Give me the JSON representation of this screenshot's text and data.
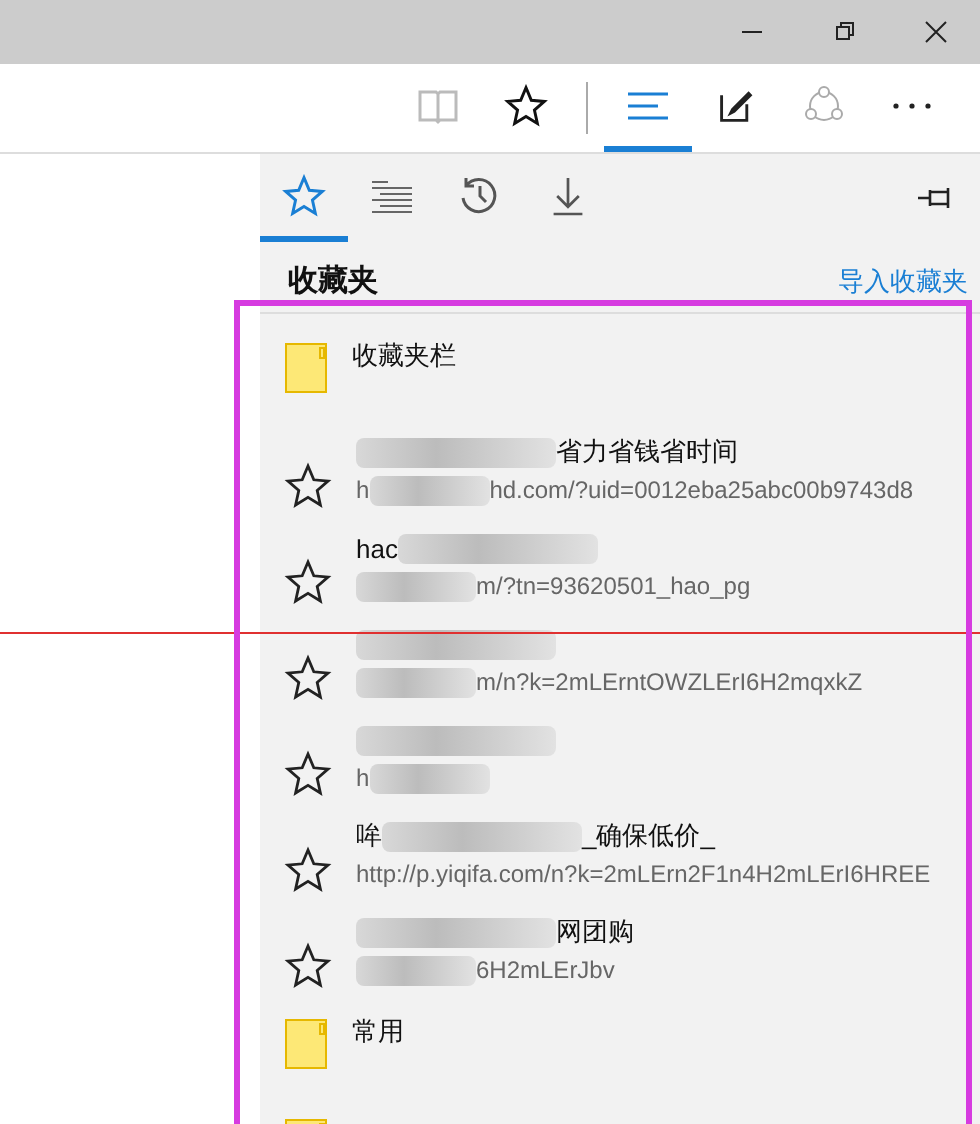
{
  "toolbar": {
    "buttons": [
      {
        "kind": "reading"
      },
      {
        "kind": "star"
      },
      {
        "kind": "divider"
      },
      {
        "kind": "hub",
        "selected": true
      },
      {
        "kind": "note",
        "selected": false
      },
      {
        "kind": "share",
        "selected": false
      },
      {
        "kind": "more",
        "selected": false
      }
    ]
  },
  "hub": {
    "tabs": [
      {
        "kind": "favorites",
        "selected": true
      },
      {
        "kind": "reading-list",
        "selected": false
      },
      {
        "kind": "history",
        "selected": false
      },
      {
        "kind": "downloads",
        "selected": false
      }
    ],
    "title": "收藏夹",
    "import_link": "导入收藏夹",
    "items": [
      {
        "kind": "folder",
        "name": "收藏夹栏"
      },
      {
        "kind": "favorite",
        "title": {
          "blurred": true,
          "text": "省力省钱省时间"
        },
        "url": {
          "lead": "h",
          "blurred": true,
          "text": "hd.com/?uid=0012eba25abc00b9743d8"
        }
      },
      {
        "kind": "favorite",
        "title": {
          "lead": "hac",
          "blurred": true
        },
        "url": {
          "blurred": true,
          "text": "m/?tn=93620501_hao_pg"
        }
      },
      {
        "kind": "favorite",
        "title": {
          "blurred": true
        },
        "url": {
          "blurred": true,
          "text": "m/n?k=2mLErntOWZLErI6H2mqxkZ"
        }
      },
      {
        "kind": "favorite",
        "title": {
          "blurred": true
        },
        "url": {
          "lead": "h",
          "blurred": true
        }
      },
      {
        "kind": "favorite",
        "title": {
          "lead": "哞",
          "blurred": true,
          "text": "_确保低价_"
        },
        "url": {
          "text": "http://p.yiqifa.com/n?k=2mLErn2F1n4H2mLErI6HREE"
        }
      },
      {
        "kind": "favorite",
        "title": {
          "blurred": true,
          "text": "网团购"
        },
        "url": {
          "blurred": true,
          "text": "6H2mLErJbv"
        }
      },
      {
        "kind": "folder",
        "name": "常用"
      },
      {
        "kind": "folder"
      }
    ]
  }
}
